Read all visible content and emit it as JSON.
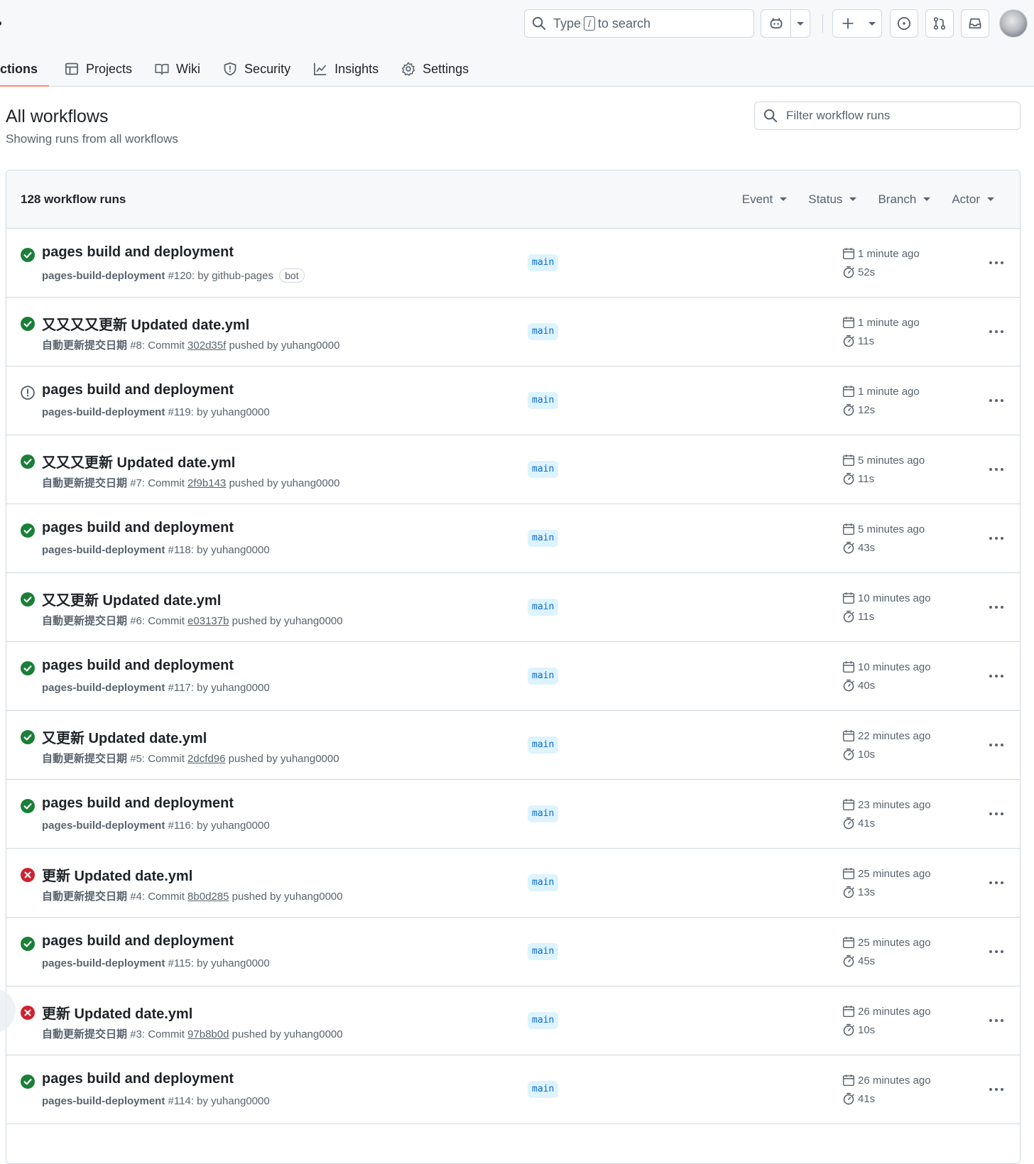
{
  "header": {
    "search_prefix": "Type",
    "search_kbd": "/",
    "search_suffix": "to search"
  },
  "tabs": [
    {
      "label": "ctions",
      "icon": "play-icon",
      "active": true
    },
    {
      "label": "Projects",
      "icon": "table-icon"
    },
    {
      "label": "Wiki",
      "icon": "book-icon"
    },
    {
      "label": "Security",
      "icon": "shield-icon"
    },
    {
      "label": "Insights",
      "icon": "graph-icon"
    },
    {
      "label": "Settings",
      "icon": "gear-icon"
    }
  ],
  "page": {
    "title": "All workflows",
    "subtitle": "Showing runs from all workflows",
    "filter_placeholder": "Filter workflow runs"
  },
  "runs_header": {
    "count": "128 workflow runs",
    "filters": [
      "Event",
      "Status",
      "Branch",
      "Actor"
    ]
  },
  "colors": {
    "success": "#1a7f37",
    "failure": "#cf222e",
    "neutral": "#59636e",
    "branch_bg": "#ddf4ff",
    "branch_fg": "#0969da"
  },
  "runs": [
    {
      "status": "success",
      "title": "pages build and deployment",
      "workflow": "pages-build-deployment",
      "meta_prefix": "#120: by github-pages",
      "sha": "",
      "meta_suffix": "",
      "bot": "bot",
      "branch": "main",
      "when": "1 minute ago",
      "duration": "52s"
    },
    {
      "status": "success",
      "title": "又又又又更新 Updated date.yml",
      "workflow": "自動更新提交日期",
      "meta_prefix": "#8: Commit",
      "sha": "302d35f",
      "meta_suffix": "pushed by yuhang0000",
      "bot": "",
      "branch": "main",
      "when": "1 minute ago",
      "duration": "11s"
    },
    {
      "status": "neutral",
      "title": "pages build and deployment",
      "workflow": "pages-build-deployment",
      "meta_prefix": "#119: by yuhang0000",
      "sha": "",
      "meta_suffix": "",
      "bot": "",
      "branch": "main",
      "when": "1 minute ago",
      "duration": "12s"
    },
    {
      "status": "success",
      "title": "又又又更新 Updated date.yml",
      "workflow": "自動更新提交日期",
      "meta_prefix": "#7: Commit",
      "sha": "2f9b143",
      "meta_suffix": "pushed by yuhang0000",
      "bot": "",
      "branch": "main",
      "when": "5 minutes ago",
      "duration": "11s"
    },
    {
      "status": "success",
      "title": "pages build and deployment",
      "workflow": "pages-build-deployment",
      "meta_prefix": "#118: by yuhang0000",
      "sha": "",
      "meta_suffix": "",
      "bot": "",
      "branch": "main",
      "when": "5 minutes ago",
      "duration": "43s"
    },
    {
      "status": "success",
      "title": "又又更新 Updated date.yml",
      "workflow": "自動更新提交日期",
      "meta_prefix": "#6: Commit",
      "sha": "e03137b",
      "meta_suffix": "pushed by yuhang0000",
      "bot": "",
      "branch": "main",
      "when": "10 minutes ago",
      "duration": "11s"
    },
    {
      "status": "success",
      "title": "pages build and deployment",
      "workflow": "pages-build-deployment",
      "meta_prefix": "#117: by yuhang0000",
      "sha": "",
      "meta_suffix": "",
      "bot": "",
      "branch": "main",
      "when": "10 minutes ago",
      "duration": "40s"
    },
    {
      "status": "success",
      "title": "又更新 Updated date.yml",
      "workflow": "自動更新提交日期",
      "meta_prefix": "#5: Commit",
      "sha": "2dcfd96",
      "meta_suffix": "pushed by yuhang0000",
      "bot": "",
      "branch": "main",
      "when": "22 minutes ago",
      "duration": "10s"
    },
    {
      "status": "success",
      "title": "pages build and deployment",
      "workflow": "pages-build-deployment",
      "meta_prefix": "#116: by yuhang0000",
      "sha": "",
      "meta_suffix": "",
      "bot": "",
      "branch": "main",
      "when": "23 minutes ago",
      "duration": "41s"
    },
    {
      "status": "failure",
      "title": "更新 Updated date.yml",
      "workflow": "自動更新提交日期",
      "meta_prefix": "#4: Commit",
      "sha": "8b0d285",
      "meta_suffix": "pushed by yuhang0000",
      "bot": "",
      "branch": "main",
      "when": "25 minutes ago",
      "duration": "13s"
    },
    {
      "status": "success",
      "title": "pages build and deployment",
      "workflow": "pages-build-deployment",
      "meta_prefix": "#115: by yuhang0000",
      "sha": "",
      "meta_suffix": "",
      "bot": "",
      "branch": "main",
      "when": "25 minutes ago",
      "duration": "45s"
    },
    {
      "status": "failure",
      "title": "更新 Updated date.yml",
      "workflow": "自動更新提交日期",
      "meta_prefix": "#3: Commit",
      "sha": "97b8b0d",
      "meta_suffix": "pushed by yuhang0000",
      "bot": "",
      "branch": "main",
      "when": "26 minutes ago",
      "duration": "10s"
    },
    {
      "status": "success",
      "title": "pages build and deployment",
      "workflow": "pages-build-deployment",
      "meta_prefix": "#114: by yuhang0000",
      "sha": "",
      "meta_suffix": "",
      "bot": "",
      "branch": "main",
      "when": "26 minutes ago",
      "duration": "41s"
    }
  ]
}
